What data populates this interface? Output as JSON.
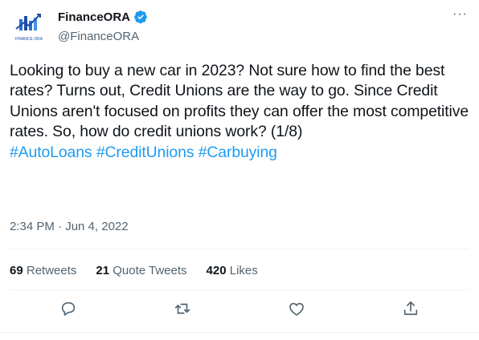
{
  "author": {
    "display_name": "FinanceORA",
    "handle": "@FinanceORA",
    "avatar_text": "FINANCE ORA",
    "verified_icon": "verified-badge-icon"
  },
  "tweet": {
    "text": "Looking to buy a new car in 2023? Not sure how to find the best rates? Turns out, Credit Unions are the way to go. Since Credit Unions aren't focused on profits they can offer the most competitive rates. So, how do credit unions work? (1/8)",
    "hashtags": [
      "#AutoLoans",
      "#CreditUnions",
      "#Carbuying"
    ],
    "timestamp": "2:34 PM · Jun 4, 2022"
  },
  "stats": {
    "retweets_count": "69",
    "retweets_label": "Retweets",
    "quotes_count": "21",
    "quotes_label": "Quote Tweets",
    "likes_count": "420",
    "likes_label": "Likes"
  },
  "menu": {
    "more_label": "···"
  },
  "actions": {
    "reply_icon": "reply-icon",
    "retweet_icon": "retweet-icon",
    "like_icon": "heart-icon",
    "share_icon": "share-icon"
  },
  "colors": {
    "accent": "#1d9bf0",
    "text": "#0f1419",
    "secondary": "#536471",
    "divider": "#eff3f4"
  }
}
